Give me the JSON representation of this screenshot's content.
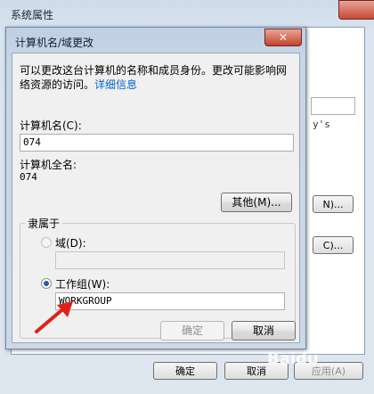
{
  "background_window": {
    "title": "系统属性",
    "fragment_text": "y's",
    "fragment_button_1": "N)...",
    "fragment_button_2": "C)...",
    "ok_label": "确定",
    "cancel_label": "取消",
    "apply_label": "应用(A)"
  },
  "dialog": {
    "title": "计算机名/域更改",
    "close_glyph": "✕",
    "description": "可以更改这台计算机的名称和成员身份。更改可能影响网",
    "description_line2": "络资源的访问。",
    "details_link": "详细信息",
    "computer_name_label": "计算机名(C):",
    "computer_name_value": "074",
    "full_name_label": "计算机全名:",
    "full_name_value": "074",
    "more_button": "其他(M)...",
    "member_of_label": "隶属于",
    "domain_label": "域(D):",
    "domain_value": "",
    "workgroup_label": "工作组(W):",
    "workgroup_value": "WORKGROUP",
    "ok_label": "确定",
    "cancel_label": "取消"
  },
  "overlay": {
    "watermark": "Baidu",
    "arrow_color": "#e0201a"
  }
}
